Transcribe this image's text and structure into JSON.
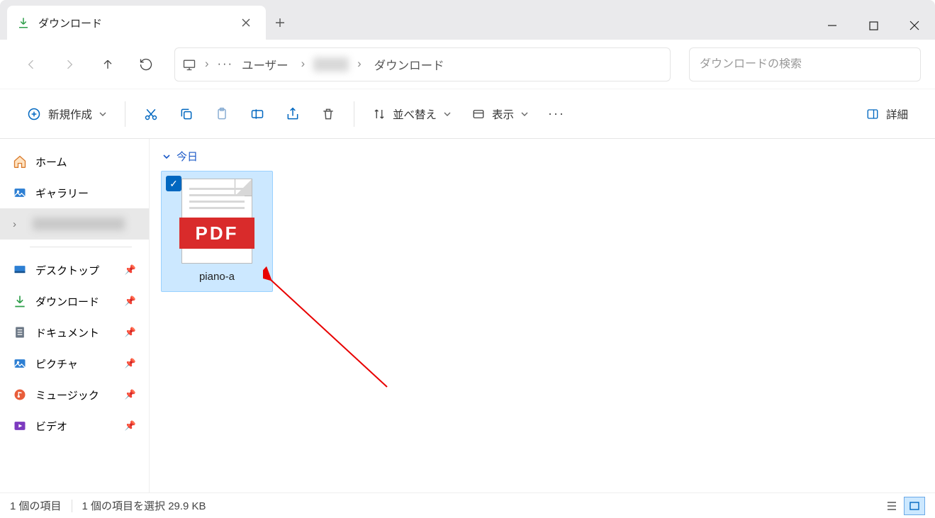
{
  "tab": {
    "title": "ダウンロード"
  },
  "breadcrumb": {
    "user_label": "ユーザー",
    "current": "ダウンロード"
  },
  "search": {
    "placeholder": "ダウンロードの検索"
  },
  "toolbar": {
    "new_label": "新規作成",
    "sort_label": "並べ替え",
    "view_label": "表示",
    "details_label": "詳細"
  },
  "sidebar": {
    "home": "ホーム",
    "gallery": "ギャラリー",
    "desktop": "デスクトップ",
    "downloads": "ダウンロード",
    "documents": "ドキュメント",
    "pictures": "ピクチャ",
    "music": "ミュージック",
    "videos": "ビデオ"
  },
  "content": {
    "group": "今日",
    "file": {
      "name": "piano-a",
      "type": "PDF"
    }
  },
  "status": {
    "count": "1 個の項目",
    "selected": "1 個の項目を選択 29.9 KB"
  }
}
